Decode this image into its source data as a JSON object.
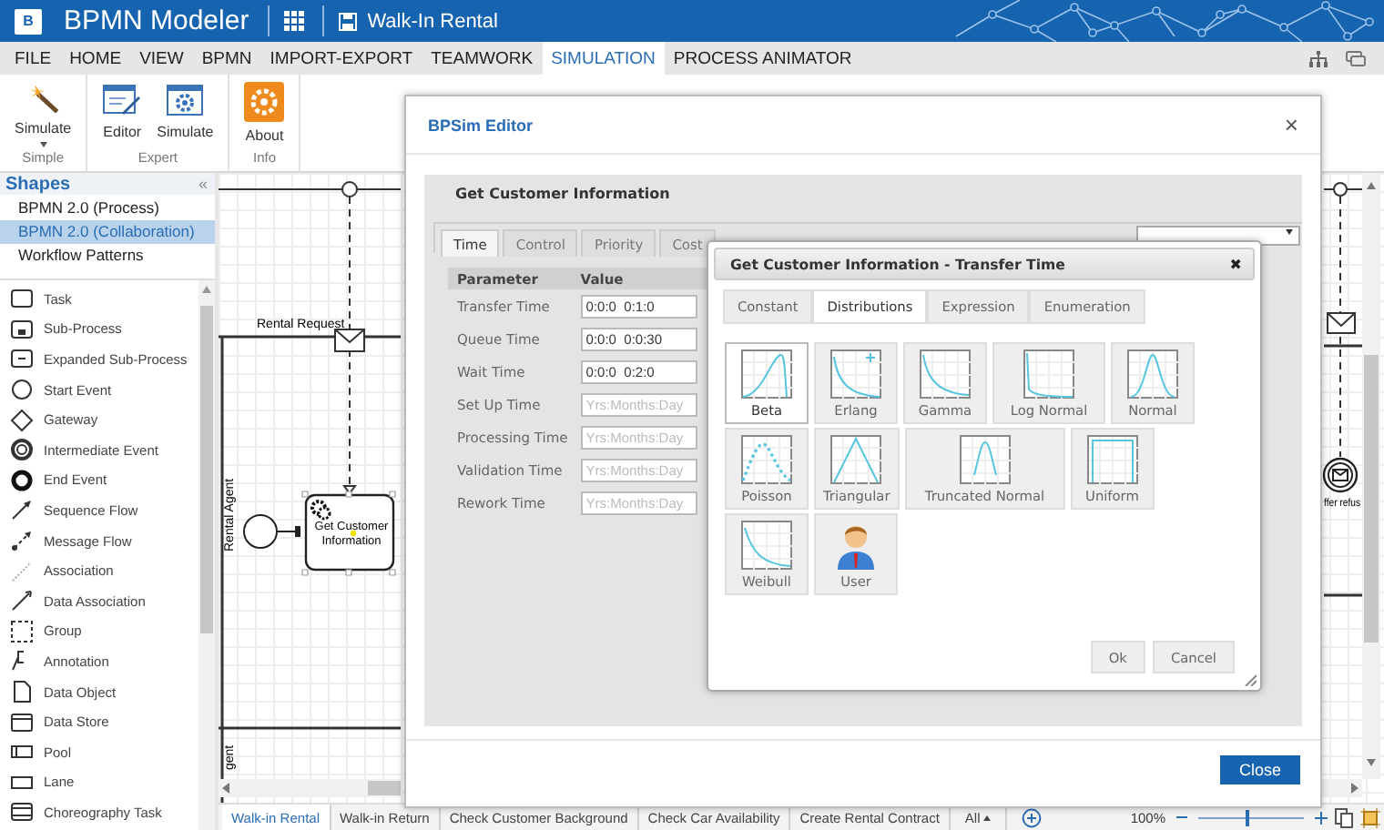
{
  "app": {
    "logo": "B",
    "title": "BPMN Modeler",
    "document": "Walk-In Rental"
  },
  "menu": [
    {
      "label": "FILE",
      "selected": false
    },
    {
      "label": "HOME",
      "selected": false
    },
    {
      "label": "VIEW",
      "selected": false
    },
    {
      "label": "BPMN",
      "selected": false
    },
    {
      "label": "IMPORT-EXPORT",
      "selected": false
    },
    {
      "label": "TEAMWORK",
      "selected": false
    },
    {
      "label": "SIMULATION",
      "selected": true
    },
    {
      "label": "PROCESS ANIMATOR",
      "selected": false
    }
  ],
  "ribbon": [
    {
      "label": "Simple",
      "buttons": [
        {
          "label": "Simulate",
          "dropdown": true
        }
      ]
    },
    {
      "label": "Expert",
      "buttons": [
        {
          "label": "Editor",
          "dropdown": false
        },
        {
          "label": "Simulate",
          "dropdown": false
        }
      ]
    },
    {
      "label": "Info",
      "buttons": [
        {
          "label": "About",
          "dropdown": false
        }
      ]
    }
  ],
  "shapes": {
    "title": "Shapes",
    "collapse": "«",
    "libraries": [
      {
        "label": "BPMN 2.0 (Process)",
        "selected": false
      },
      {
        "label": "BPMN 2.0 (Collaboration)",
        "selected": true
      },
      {
        "label": "Workflow Patterns",
        "selected": false
      }
    ],
    "items": [
      "Task",
      "Sub-Process",
      "Expanded Sub-Process",
      "Start Event",
      "Gateway",
      "Intermediate Event",
      "End Event",
      "Sequence Flow",
      "Message Flow",
      "Association",
      "Data Association",
      "Group",
      "Annotation",
      "Data Object",
      "Data Store",
      "Pool",
      "Lane",
      "Choreography Task"
    ]
  },
  "diagram": {
    "message_label": "Rental Request",
    "lane_label": "Rental Agent",
    "task_label": "Get Customer Information",
    "right_event_label": "ffer refus",
    "lower_lane_label": "gent"
  },
  "sheet_tabs": [
    {
      "label": "Walk-in Rental",
      "selected": true
    },
    {
      "label": "Walk-in Return",
      "selected": false
    },
    {
      "label": "Check Customer Background",
      "selected": false
    },
    {
      "label": "Check Car Availability",
      "selected": false
    },
    {
      "label": "Create Rental Contract",
      "selected": false
    }
  ],
  "all_menu": "All",
  "zoom": {
    "reading": "100%",
    "level": 0.45
  },
  "bpsim": {
    "title": "BPSim Editor",
    "close": "×",
    "task": "Get Customer Information",
    "tabs": [
      {
        "label": "Time",
        "selected": true
      },
      {
        "label": "Control",
        "selected": false
      },
      {
        "label": "Priority",
        "selected": false
      },
      {
        "label": "Cost",
        "selected": false
      }
    ],
    "columns": [
      "Parameter",
      "Value"
    ],
    "rows": [
      {
        "name": "Transfer Time",
        "value": "0:0:0  0:1:0"
      },
      {
        "name": "Queue Time",
        "value": "0:0:0  0:0:30"
      },
      {
        "name": "Wait Time",
        "value": "0:0:0  0:2:0"
      },
      {
        "name": "Set Up Time",
        "placeholder": "Yrs:Months:Day"
      },
      {
        "name": "Processing Time",
        "placeholder": "Yrs:Months:Day"
      },
      {
        "name": "Validation Time",
        "placeholder": "Yrs:Months:Day"
      },
      {
        "name": "Rework Time",
        "placeholder": "Yrs:Months:Day"
      }
    ],
    "close_button": "Close"
  },
  "transfer": {
    "title": "Get Customer Information - Transfer Time",
    "close": "✖",
    "tabs": [
      {
        "label": "Constant",
        "selected": false
      },
      {
        "label": "Distributions",
        "selected": true
      },
      {
        "label": "Expression",
        "selected": false
      },
      {
        "label": "Enumeration",
        "selected": false
      }
    ],
    "options": [
      {
        "label": "Beta",
        "kind": "distribution",
        "selected": true
      },
      {
        "label": "Erlang",
        "kind": "distribution",
        "selected": false
      },
      {
        "label": "Gamma",
        "kind": "distribution",
        "selected": false
      },
      {
        "label": "Log Normal",
        "kind": "distribution",
        "selected": false
      },
      {
        "label": "Normal",
        "kind": "distribution",
        "selected": false
      },
      {
        "label": "Poisson",
        "kind": "distribution",
        "selected": false
      },
      {
        "label": "Triangular",
        "kind": "distribution",
        "selected": false
      },
      {
        "label": "Truncated Normal",
        "kind": "distribution",
        "selected": false
      },
      {
        "label": "Uniform",
        "kind": "distribution",
        "selected": false
      },
      {
        "label": "Weibull",
        "kind": "distribution",
        "selected": false
      },
      {
        "label": "User",
        "kind": "user",
        "selected": false
      }
    ],
    "buttons": [
      "Ok",
      "Cancel"
    ]
  }
}
